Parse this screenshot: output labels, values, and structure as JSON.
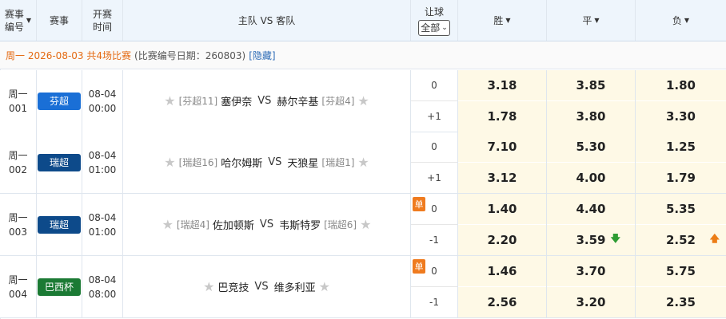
{
  "header": {
    "num_label": "赛事编号",
    "num_line1": "赛事",
    "num_line2": "编号",
    "league_label": "赛事",
    "time_line1": "开赛",
    "time_line2": "时间",
    "match_label": "主队 VS 客队",
    "handicap_label": "让球",
    "handicap_select": "全部",
    "win_label": "胜",
    "draw_label": "平",
    "lose_label": "负"
  },
  "datebar": {
    "day_info": "周一 2026-08-03 共4场比赛",
    "id_info": "(比赛编号日期：260803)",
    "hide_link": "[隐藏]"
  },
  "matches": [
    {
      "day": "周一",
      "num": "001",
      "league": "芬超",
      "league_color": "#1a6fd6",
      "date": "08-04",
      "time": "00:00",
      "home_rank": "[芬超11]",
      "home": "塞伊奈",
      "vs": "VS",
      "away": "赫尔辛基",
      "away_rank": "[芬超4]",
      "single": "",
      "hc": [
        "0",
        "+1"
      ],
      "odds": [
        [
          "3.18",
          "3.85",
          "1.80"
        ],
        [
          "1.78",
          "3.80",
          "3.30"
        ]
      ]
    },
    {
      "day": "周一",
      "num": "002",
      "league": "瑞超",
      "league_color": "#0d4a8a",
      "date": "08-04",
      "time": "01:00",
      "home_rank": "[瑞超16]",
      "home": "哈尔姆斯",
      "vs": "VS",
      "away": "天狼星",
      "away_rank": "[瑞超1]",
      "single": "",
      "hc": [
        "0",
        "+1"
      ],
      "odds": [
        [
          "7.10",
          "5.30",
          "1.25"
        ],
        [
          "3.12",
          "4.00",
          "1.79"
        ]
      ]
    },
    {
      "day": "周一",
      "num": "003",
      "league": "瑞超",
      "league_color": "#0d4a8a",
      "date": "08-04",
      "time": "01:00",
      "home_rank": "[瑞超4]",
      "home": "佐加顿斯",
      "vs": "VS",
      "away": "韦斯特罗",
      "away_rank": "[瑞超6]",
      "single": "单",
      "hc": [
        "0",
        "-1"
      ],
      "odds": [
        [
          "1.40",
          "4.40",
          "5.35"
        ],
        [
          "2.20",
          "3.59",
          "2.52"
        ]
      ]
    },
    {
      "day": "周一",
      "num": "004",
      "league": "巴西杯",
      "league_color": "#1b7a34",
      "date": "08-04",
      "time": "08:00",
      "home_rank": "",
      "home": "巴竞技",
      "vs": "VS",
      "away": "维多利亚",
      "away_rank": "",
      "single": "单",
      "hc": [
        "0",
        "-1"
      ],
      "odds": [
        [
          "1.46",
          "3.70",
          "5.75"
        ],
        [
          "2.56",
          "3.20",
          "2.35"
        ]
      ]
    }
  ],
  "trend": {
    "down_icon": "arrow-down-icon",
    "up_icon": "arrow-up-icon",
    "down_color": "#2e9c33",
    "up_color": "#ec7d16"
  }
}
